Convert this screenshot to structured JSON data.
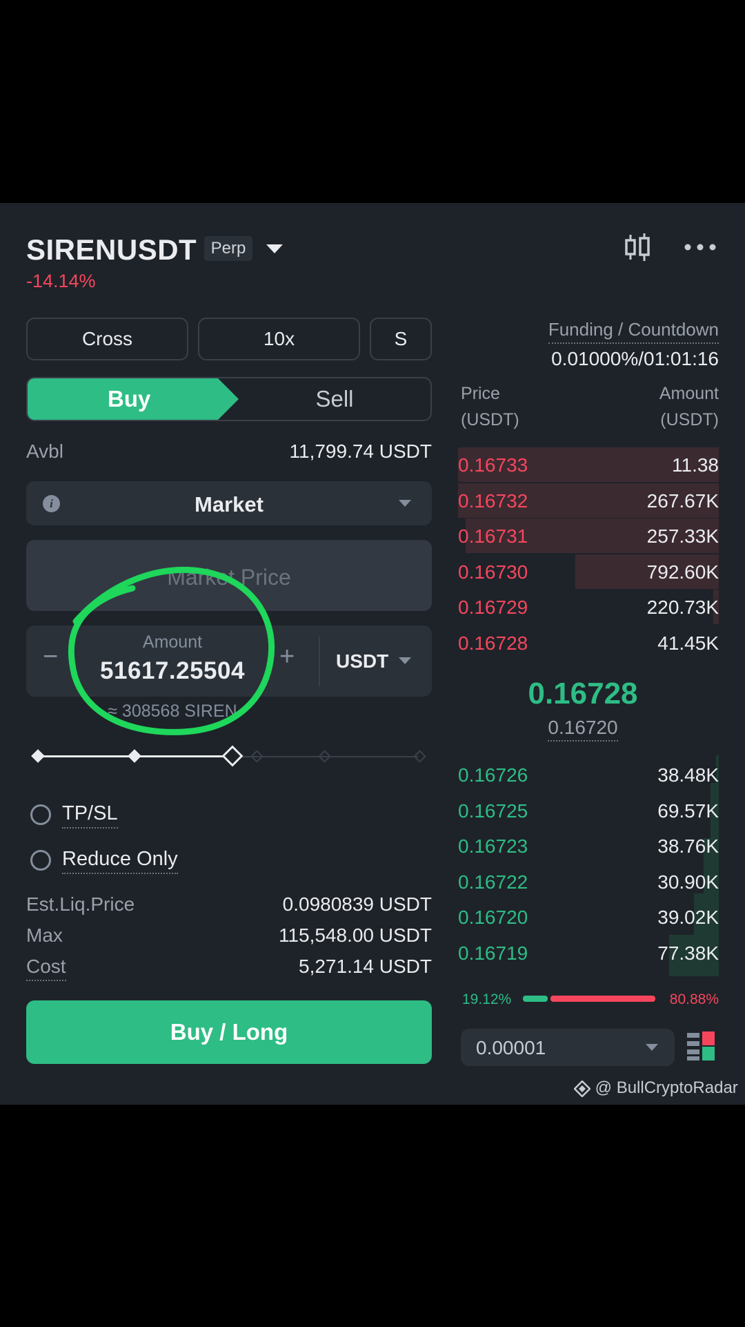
{
  "header": {
    "symbol": "SIRENUSDT",
    "contract_badge": "Perp",
    "change": "-14.14%"
  },
  "controls": {
    "margin_mode": "Cross",
    "leverage": "10x",
    "mode_short": "S"
  },
  "tabs": {
    "buy": "Buy",
    "sell": "Sell"
  },
  "avbl": {
    "label": "Avbl",
    "value": "11,799.74 USDT"
  },
  "order_type": {
    "selected": "Market"
  },
  "price_field": {
    "placeholder": "Market Price"
  },
  "amount": {
    "label": "Amount",
    "value": "51617.25504",
    "unit": "USDT",
    "approx": "≈ 308568 SIREN",
    "minus": "−",
    "plus": "+"
  },
  "slider": {
    "percent": 50
  },
  "options": {
    "tpsl": "TP/SL",
    "reduce_only": "Reduce Only"
  },
  "info": {
    "liq_label": "Est.Liq.Price",
    "liq_value": "0.0980839 USDT",
    "max_label": "Max",
    "max_value": "115,548.00 USDT",
    "cost_label": "Cost",
    "cost_value": "5,271.14 USDT"
  },
  "submit": {
    "label": "Buy / Long"
  },
  "funding": {
    "label": "Funding / Countdown",
    "value": "0.01000%/01:01:16"
  },
  "orderbook": {
    "price_header": "Price",
    "price_unit": "(USDT)",
    "amount_header": "Amount",
    "amount_unit": "(USDT)",
    "asks": [
      {
        "price": "0.16733",
        "amount": "11.38",
        "depth": 1.0
      },
      {
        "price": "0.16732",
        "amount": "267.67K",
        "depth": 1.0
      },
      {
        "price": "0.16731",
        "amount": "257.33K",
        "depth": 0.97
      },
      {
        "price": "0.16730",
        "amount": "792.60K",
        "depth": 0.55
      },
      {
        "price": "0.16729",
        "amount": "220.73K",
        "depth": 0.02
      },
      {
        "price": "0.16728",
        "amount": "41.45K",
        "depth": 0.0
      }
    ],
    "last_price": "0.16728",
    "mark_price": "0.16720",
    "bids": [
      {
        "price": "0.16726",
        "amount": "38.48K"
      },
      {
        "price": "0.16725",
        "amount": "69.57K"
      },
      {
        "price": "0.16723",
        "amount": "38.76K"
      },
      {
        "price": "0.16722",
        "amount": "30.90K"
      },
      {
        "price": "0.16720",
        "amount": "39.02K"
      },
      {
        "price": "0.16719",
        "amount": "77.38K"
      }
    ],
    "buy_ratio": "19.12%",
    "sell_ratio": "80.88%",
    "tick_size": "0.00001"
  },
  "watermark": "@ BullCryptoRadar",
  "colors": {
    "background": "#1e2329",
    "green": "#2ebd85",
    "red": "#f6465d",
    "annotation_circle": "#1ed75b"
  }
}
